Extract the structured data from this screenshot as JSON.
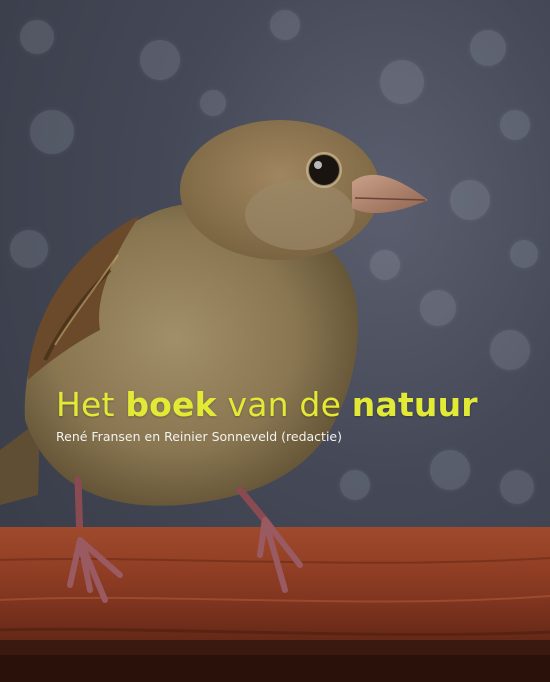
{
  "cover": {
    "title_part1": "Het ",
    "title_part2": "boek",
    "title_part3": " van de ",
    "title_part4": "natuur",
    "subtitle": "René Fransen en Reinier Sonneveld (redactie)"
  },
  "colors": {
    "title": "#e2ea36",
    "subtitle": "#f2f2ef",
    "background": "#454957",
    "wood": "#8a3a22",
    "bird_body": "#8c7a55"
  }
}
